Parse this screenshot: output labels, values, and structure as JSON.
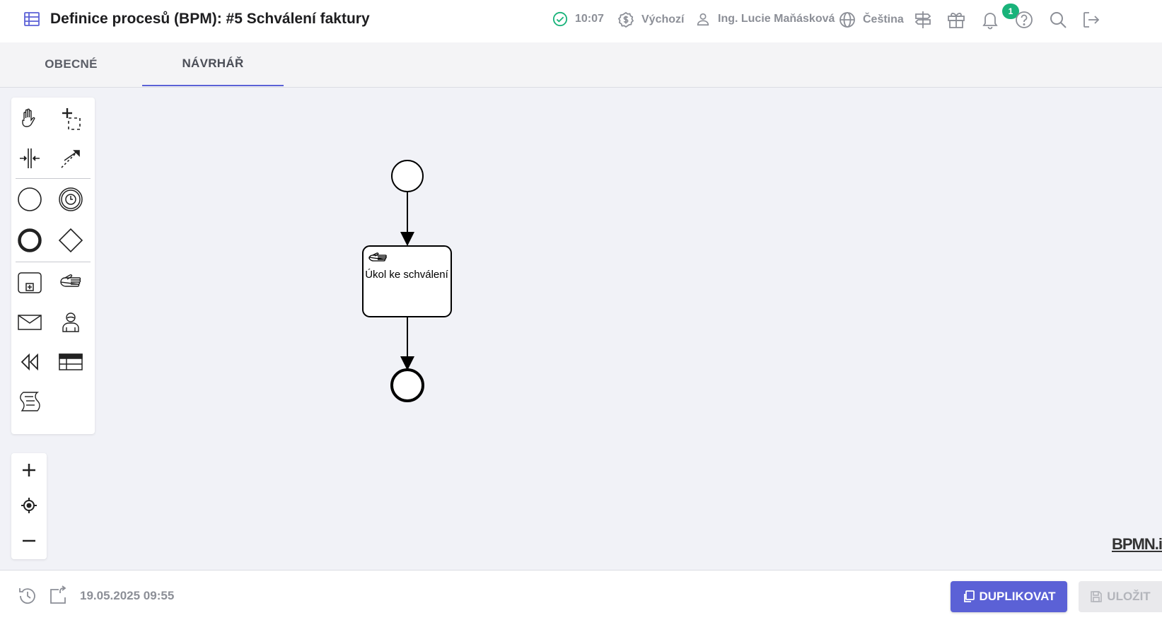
{
  "header": {
    "title": "Definice procesů (BPM): #5 Schválení faktury",
    "time": "10:07",
    "currency": "Výchozí",
    "user": "Ing. Lucie Maňásková",
    "language": "Čeština",
    "gift_count": "1"
  },
  "tabs": [
    {
      "label": "OBECNÉ",
      "active": false
    },
    {
      "label": "NÁVRHÁŘ",
      "active": true
    }
  ],
  "diagram": {
    "task_label": "Úkol ke schválení",
    "watermark": "BPMN.io"
  },
  "footer": {
    "timestamp": "19.05.2025 09:55",
    "duplicate_label": "DUPLIKOVAT",
    "save_label": "ULOŽIT"
  },
  "colors": {
    "accent": "#5b61d6",
    "success": "#19b37a"
  }
}
